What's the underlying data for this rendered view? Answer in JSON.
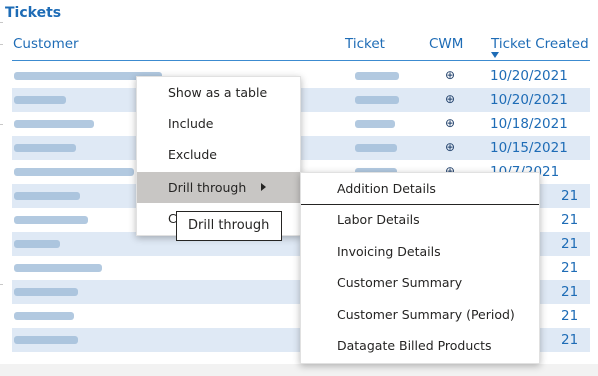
{
  "table": {
    "title": "Tickets",
    "columns": [
      "Customer",
      "Ticket",
      "CWM",
      "Ticket Created"
    ],
    "sorted_column": "Ticket Created",
    "rows": [
      {
        "created": "10/20/2021"
      },
      {
        "created": "10/20/2021"
      },
      {
        "created": "10/18/2021"
      },
      {
        "created": "10/15/2021"
      },
      {
        "created": "10/7/2021"
      },
      {
        "created": "21"
      },
      {
        "created": "21"
      },
      {
        "created": "21"
      },
      {
        "created": "21"
      },
      {
        "created": "21"
      },
      {
        "created": "21"
      },
      {
        "created": "21"
      }
    ]
  },
  "context_menu": {
    "items": [
      "Show as a table",
      "Include",
      "Exclude",
      "Drill through",
      "C"
    ],
    "active_item": "Drill through"
  },
  "drill_submenu": {
    "items": [
      "Addition Details",
      "Labor Details",
      "Invoicing Details",
      "Customer Summary",
      "Customer Summary (Period)",
      "Datagate Billed Products"
    ]
  },
  "tooltip": {
    "text": "Drill through"
  },
  "colors": {
    "header_blue": "#1e6cb6",
    "row_band": "#dfe9f5",
    "menu_active": "#c8c6c4"
  },
  "icons": {
    "cwm_link": "link-icon",
    "submenu_caret": "caret-right-icon",
    "sort": "sort-descending-icon"
  }
}
